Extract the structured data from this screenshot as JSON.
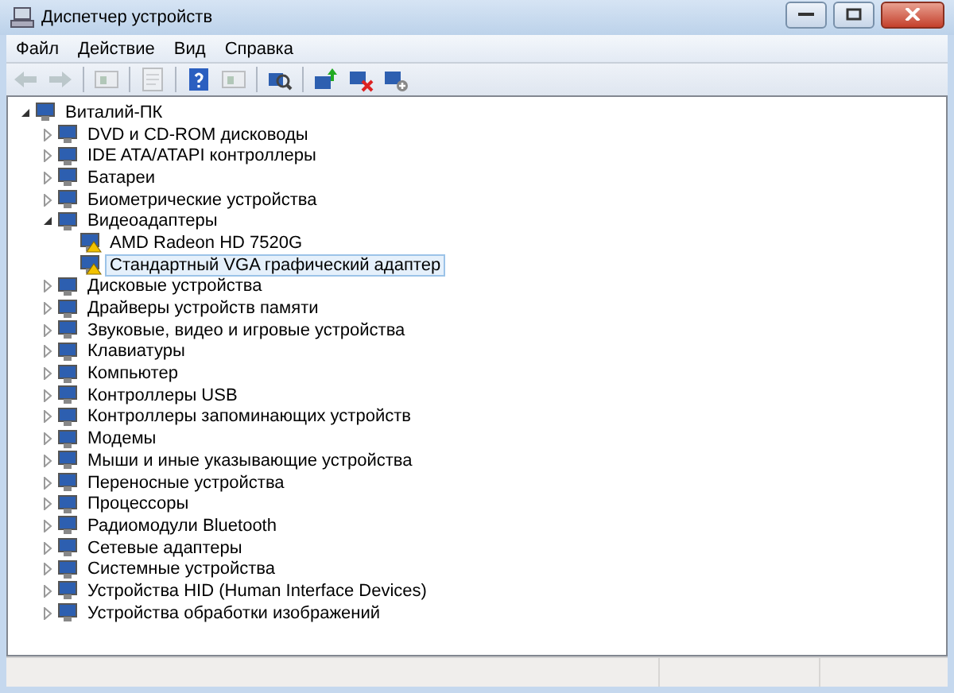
{
  "window": {
    "title": "Диспетчер устройств"
  },
  "menu": [
    "Файл",
    "Действие",
    "Вид",
    "Справка"
  ],
  "toolbar": [
    {
      "kind": "back",
      "disabled": true
    },
    {
      "kind": "forward",
      "disabled": true
    },
    {
      "kind": "sep"
    },
    {
      "kind": "panel",
      "disabled": true
    },
    {
      "kind": "sep"
    },
    {
      "kind": "sheet",
      "disabled": true
    },
    {
      "kind": "sep"
    },
    {
      "kind": "help",
      "disabled": false
    },
    {
      "kind": "panel2",
      "disabled": true
    },
    {
      "kind": "sep"
    },
    {
      "kind": "scan",
      "disabled": false
    },
    {
      "kind": "sep"
    },
    {
      "kind": "update",
      "disabled": false
    },
    {
      "kind": "remove",
      "disabled": false
    },
    {
      "kind": "add",
      "disabled": false
    }
  ],
  "tree": [
    {
      "label": "Виталий-ПК",
      "expanded": true,
      "selected": false,
      "children": [
        {
          "label": "DVD и CD-ROM дисководы",
          "expanded": false,
          "selected": false
        },
        {
          "label": "IDE ATA/ATAPI контроллеры",
          "expanded": false,
          "selected": false
        },
        {
          "label": "Батареи",
          "expanded": false,
          "selected": false
        },
        {
          "label": "Биометрические устройства",
          "expanded": false,
          "selected": false
        },
        {
          "label": "Видеоадаптеры",
          "expanded": true,
          "selected": false,
          "children": [
            {
              "label": "AMD Radeon HD 7520G",
              "warning": true,
              "selected": false
            },
            {
              "label": "Стандартный VGA графический адаптер",
              "warning": true,
              "selected": true
            }
          ]
        },
        {
          "label": "Дисковые устройства",
          "expanded": false,
          "selected": false
        },
        {
          "label": "Драйверы устройств памяти",
          "expanded": false,
          "selected": false
        },
        {
          "label": "Звуковые, видео и игровые устройства",
          "expanded": false,
          "selected": false
        },
        {
          "label": "Клавиатуры",
          "expanded": false,
          "selected": false
        },
        {
          "label": "Компьютер",
          "expanded": false,
          "selected": false
        },
        {
          "label": "Контроллеры USB",
          "expanded": false,
          "selected": false
        },
        {
          "label": "Контроллеры запоминающих устройств",
          "expanded": false,
          "selected": false
        },
        {
          "label": "Модемы",
          "expanded": false,
          "selected": false
        },
        {
          "label": "Мыши и иные указывающие устройства",
          "expanded": false,
          "selected": false
        },
        {
          "label": "Переносные устройства",
          "expanded": false,
          "selected": false
        },
        {
          "label": "Процессоры",
          "expanded": false,
          "selected": false
        },
        {
          "label": "Радиомодули Bluetooth",
          "expanded": false,
          "selected": false
        },
        {
          "label": "Сетевые адаптеры",
          "expanded": false,
          "selected": false
        },
        {
          "label": "Системные устройства",
          "expanded": false,
          "selected": false
        },
        {
          "label": "Устройства HID (Human Interface Devices)",
          "expanded": false,
          "selected": false
        },
        {
          "label": "Устройства обработки изображений",
          "expanded": false,
          "selected": false
        }
      ]
    }
  ]
}
